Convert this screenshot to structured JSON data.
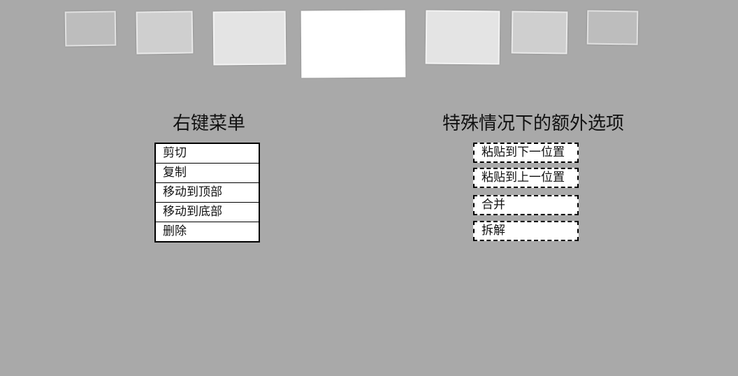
{
  "carousel": {
    "cards": [
      {
        "name": "card-1"
      },
      {
        "name": "card-2"
      },
      {
        "name": "card-3"
      },
      {
        "name": "card-4-active"
      },
      {
        "name": "card-5"
      },
      {
        "name": "card-6"
      },
      {
        "name": "card-7"
      }
    ]
  },
  "context_menu": {
    "title": "右键菜单",
    "items": [
      {
        "label": "剪切"
      },
      {
        "label": "复制"
      },
      {
        "label": "移动到顶部"
      },
      {
        "label": "移动到底部"
      },
      {
        "label": "删除"
      }
    ]
  },
  "extra_options": {
    "title": "特殊情况下的额外选项",
    "items": [
      {
        "label": "粘贴到下一位置"
      },
      {
        "label": "粘贴到上一位置"
      },
      {
        "label": "合并"
      },
      {
        "label": "拆解"
      }
    ]
  },
  "colors": {
    "background": "#a9a9a9",
    "menu_background": "#ffffff",
    "border": "#000000"
  }
}
